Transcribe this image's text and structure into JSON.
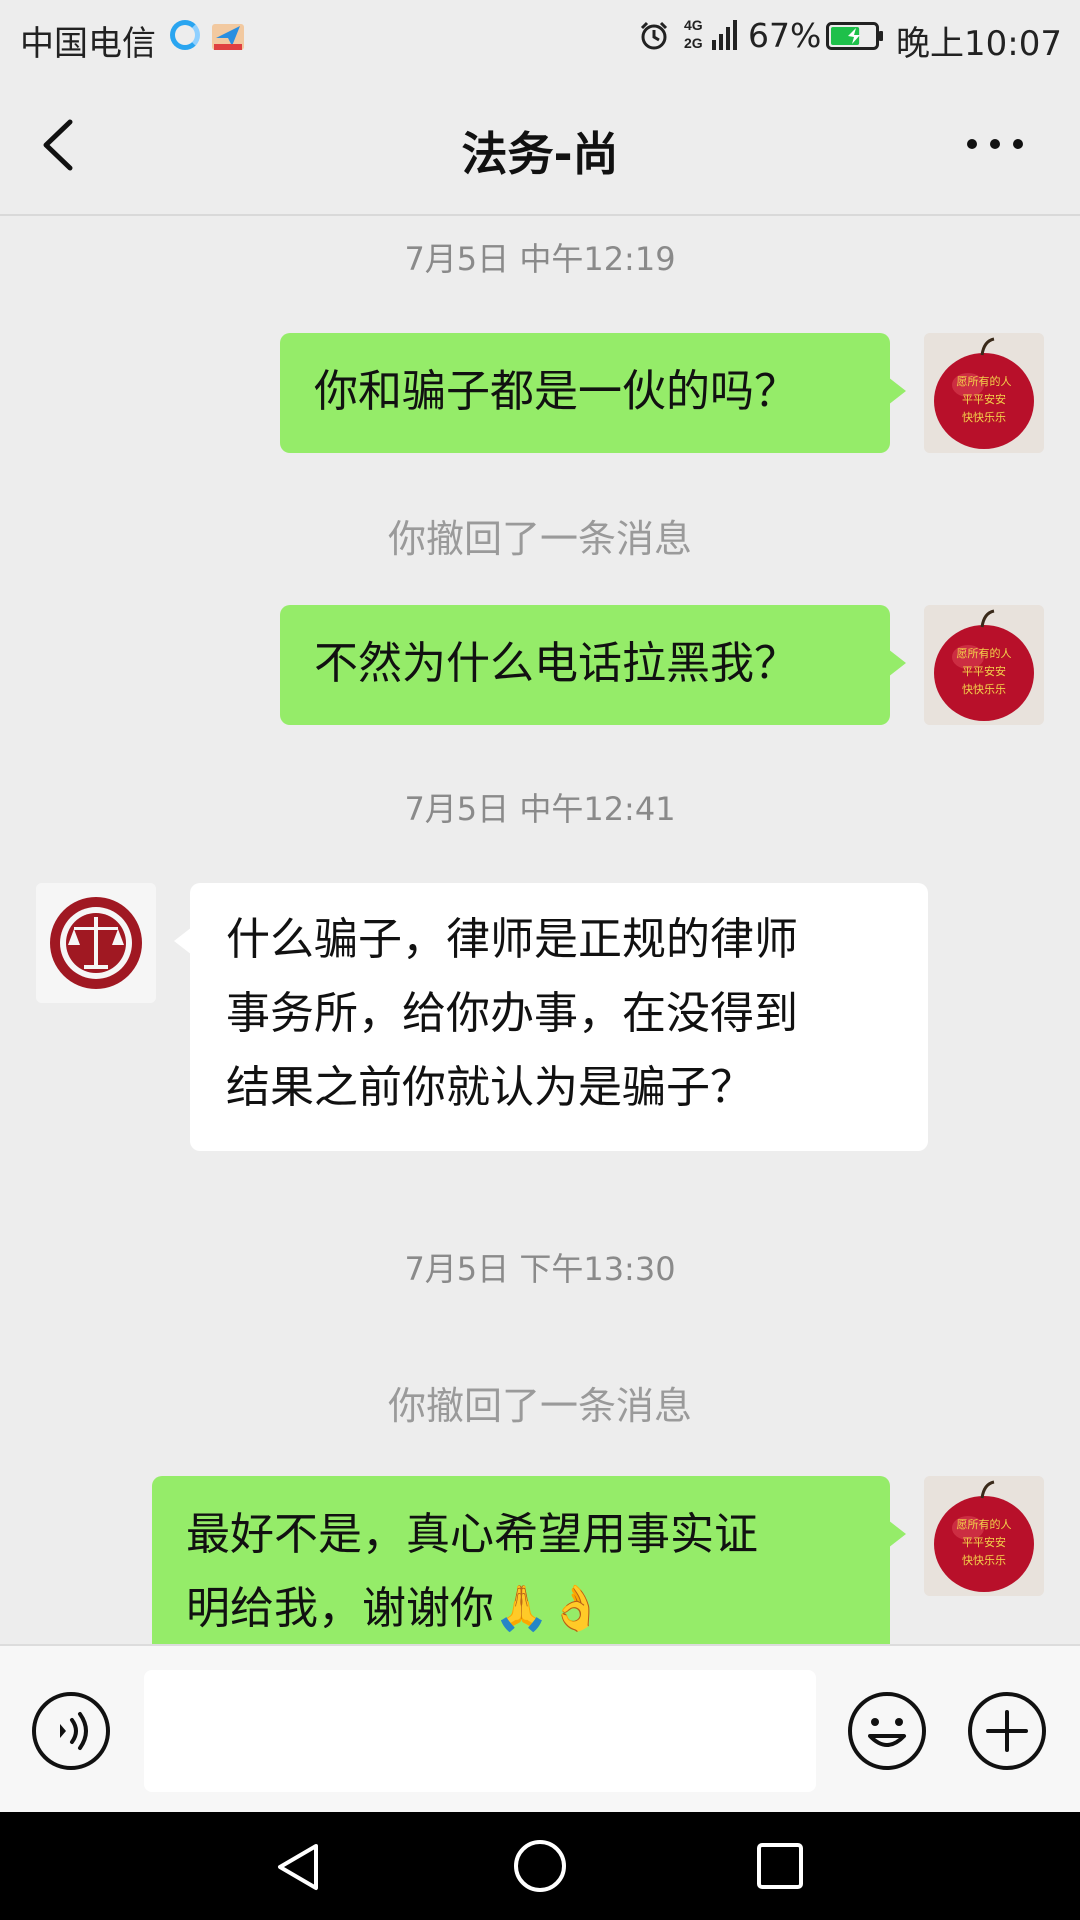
{
  "status_bar": {
    "carrier": "中国电信",
    "battery_percent": "67%",
    "time": "晚上10:07",
    "icons": [
      "browser-app-icon",
      "notification-app-icon",
      "alarm-icon",
      "signal-icon",
      "battery-icon"
    ],
    "battery_level": 0.67,
    "network_label_top": "4G",
    "network_label_bottom": "2G"
  },
  "header": {
    "title": "法务-尚",
    "back_icon": "chevron-left-icon",
    "more_icon": "more-dots-icon"
  },
  "messages": {
    "ts1": "7月5日 中午12:19",
    "m1": "你和骗子都是一伙的吗？",
    "sys1": "你撤回了一条消息",
    "m2": "不然为什么电话拉黑我？",
    "ts2": "7月5日 中午12:41",
    "m3_line1": "什么骗子，律师是正规的律师",
    "m3_line2": "事务所，给你办事，在没得到",
    "m3_line3": "结果之前你就认为是骗子？",
    "ts3": "7月5日 下午13:30",
    "sys2": "你撤回了一条消息",
    "m4_line1": "最好不是，真心希望用事实证",
    "m4_line2": "明给我，谢谢你🙏👌"
  },
  "avatars": {
    "me_lines": [
      "愿所有的人",
      "平平安安",
      "快快乐乐"
    ],
    "them": "law-firm-scales-logo"
  },
  "input_bar": {
    "placeholder": "",
    "voice_icon": "voice-icon",
    "emoji_icon": "emoji-icon",
    "plus_icon": "plus-icon"
  },
  "nav": {
    "back": "nav-back-icon",
    "home": "nav-home-icon",
    "recent": "nav-recent-icon"
  },
  "colors": {
    "bg": "#ededed",
    "bubble_me": "#95ec69",
    "bubble_them": "#ffffff",
    "timestamp": "#8a8a8a"
  }
}
